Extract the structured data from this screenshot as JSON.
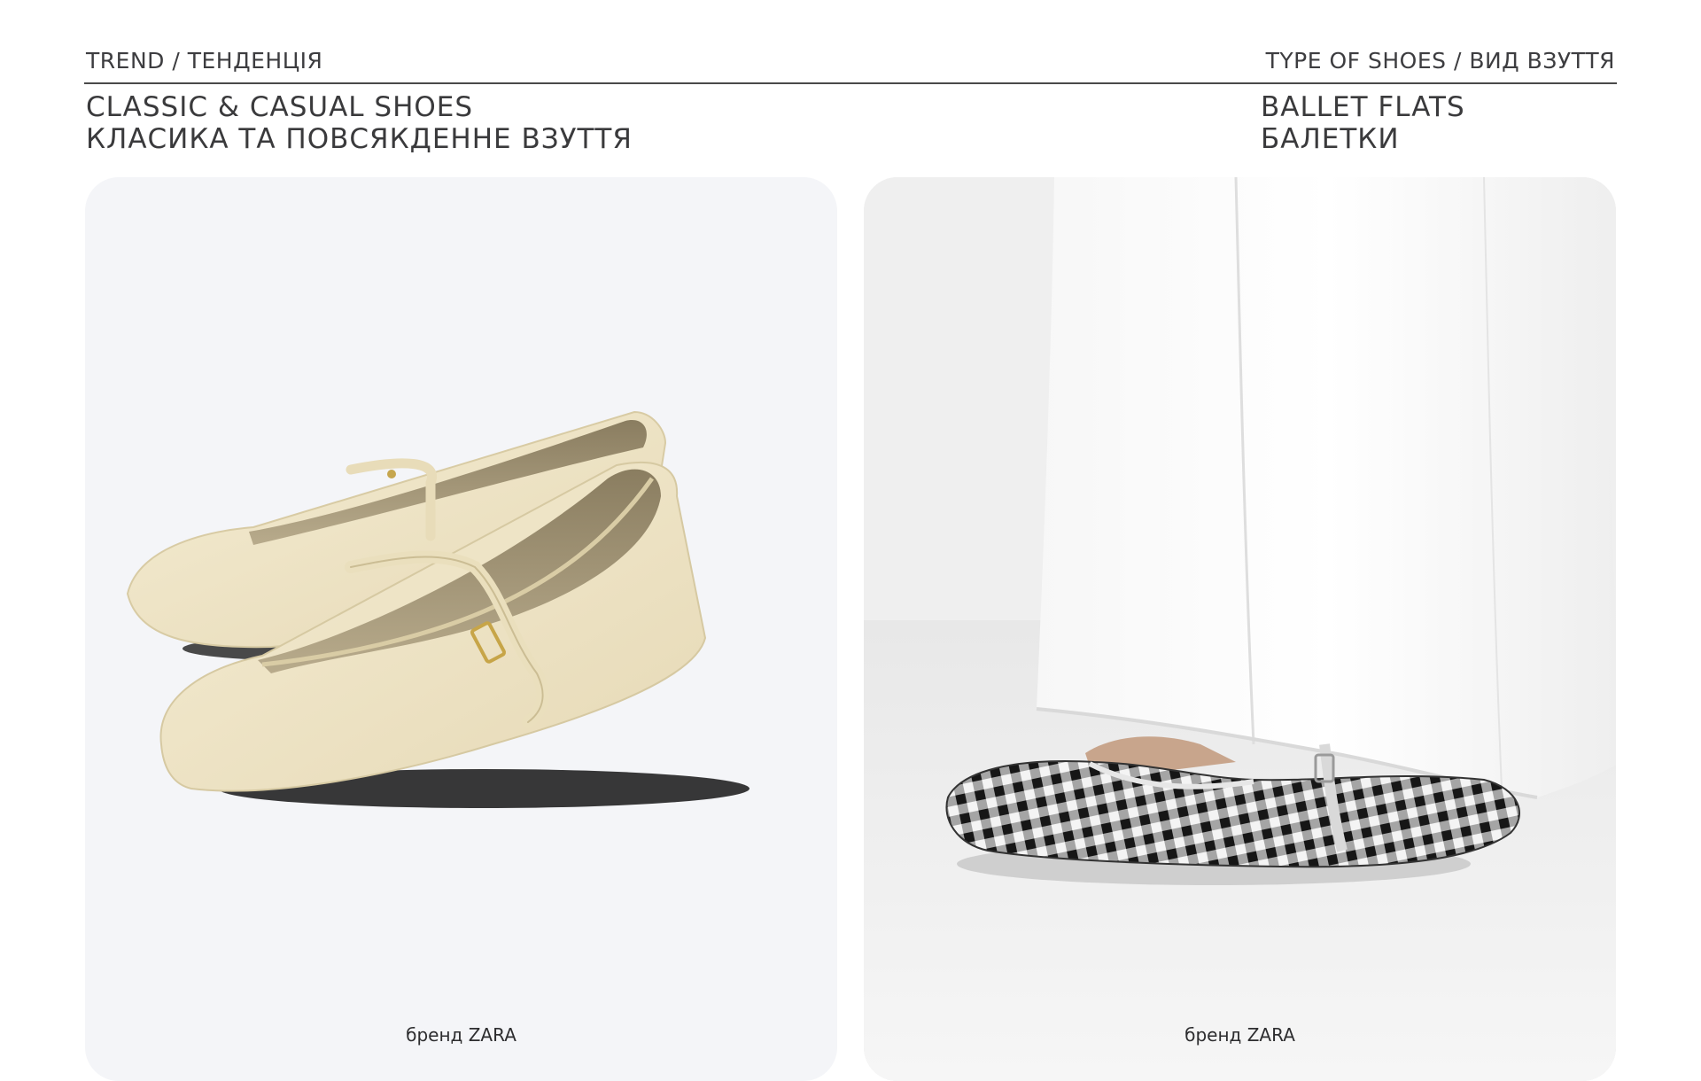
{
  "header": {
    "left_kicker": "TREND / ТЕНДЕНЦІЯ",
    "right_kicker": "TYPE OF SHOES / ВИД ВЗУТТЯ",
    "left_title_en": "CLASSIC & CASUAL SHOES",
    "left_title_uk": "КЛАСИКА ТА ПОВСЯКДЕННЕ ВЗУТТЯ",
    "right_title_en": "BALLET FLATS",
    "right_title_uk": "БАЛЕТКИ"
  },
  "cards": [
    {
      "caption": "бренд ZARA",
      "image": "cream-leather-mary-jane-ballet-flats"
    },
    {
      "caption": "бренд ZARA",
      "image": "gingham-ballet-flat-with-white-trousers"
    }
  ],
  "colors": {
    "text": "#3a3a3c",
    "shoe_cream": "#efe5c8",
    "gingham_dark": "#1c1c1c"
  }
}
